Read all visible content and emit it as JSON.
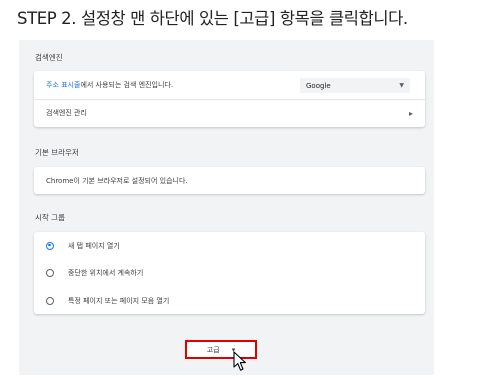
{
  "step_title": "STEP 2. 설정창 맨 하단에 있는 [고급] 항목을 클릭합니다.",
  "search_engine": {
    "section_title": "검색엔진",
    "address_bar_link": "주소 표시줄",
    "address_bar_text": "에서 사용되는 검색 엔진입니다.",
    "selected_engine": "Google",
    "manage_label": "검색엔진 관리"
  },
  "default_browser": {
    "section_title": "기본 브라우저",
    "status_text": "Chrome이 기본 브라우저로 설정되어 있습니다."
  },
  "startup": {
    "section_title": "시작 그룹",
    "options": [
      {
        "label": "새 탭 페이지 열기",
        "selected": true
      },
      {
        "label": "중단한 위치에서 계속하기",
        "selected": false
      },
      {
        "label": "특정 페이지 또는 페이지 모음 열기",
        "selected": false
      }
    ]
  },
  "advanced": {
    "label": "고급",
    "arrow": "▾"
  },
  "colors": {
    "accent": "#1a73e8",
    "highlight_border": "#e00000",
    "settings_background": "#f1f3f4"
  }
}
